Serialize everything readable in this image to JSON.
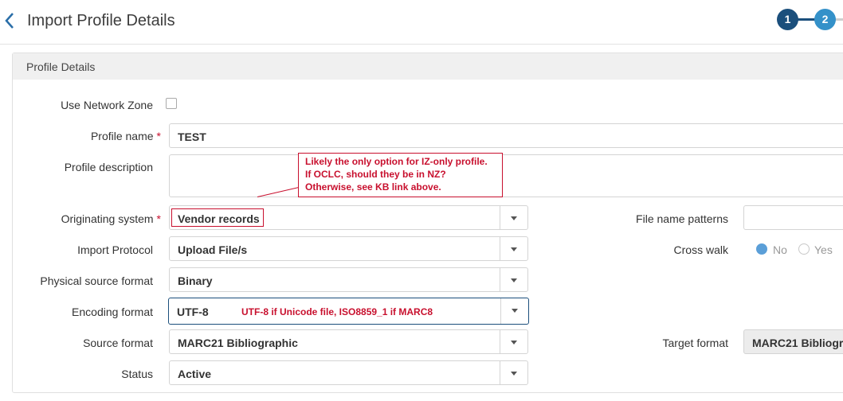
{
  "header": {
    "title": "Import Profile Details",
    "steps": [
      "1",
      "2"
    ]
  },
  "panel": {
    "title": "Profile Details"
  },
  "form": {
    "use_network_zone": {
      "label": "Use Network Zone",
      "checked": false
    },
    "profile_name": {
      "label": "Profile name",
      "required_mark": "*",
      "value": "TEST"
    },
    "profile_description": {
      "label": "Profile description",
      "value": ""
    },
    "originating_system": {
      "label": "Originating system",
      "required_mark": "*",
      "value": "Vendor records"
    },
    "import_protocol": {
      "label": "Import Protocol",
      "value": "Upload File/s"
    },
    "physical_source_format": {
      "label": "Physical source format",
      "value": "Binary"
    },
    "encoding_format": {
      "label": "Encoding format",
      "value": "UTF-8"
    },
    "source_format": {
      "label": "Source format",
      "value": "MARC21 Bibliographic"
    },
    "status": {
      "label": "Status",
      "value": "Active"
    },
    "file_name_patterns": {
      "label": "File name patterns",
      "value": ""
    },
    "cross_walk": {
      "label": "Cross walk",
      "options": [
        "No",
        "Yes"
      ],
      "selected": "No"
    },
    "target_format": {
      "label": "Target format",
      "value": "MARC21 Bibliogra"
    }
  },
  "annotations": {
    "callout_lines": [
      "Likely the only option for IZ-only profile.",
      "If OCLC, should they be in NZ?",
      "Otherwise, see KB link above."
    ],
    "encoding_note": "UTF-8 if Unicode file, ISO8859_1 if MARC8",
    "color": "#c8102e"
  },
  "colors": {
    "step_active": "#1b4f7c",
    "step_current": "#3491c9",
    "radio_selected": "#5b9fd8"
  }
}
